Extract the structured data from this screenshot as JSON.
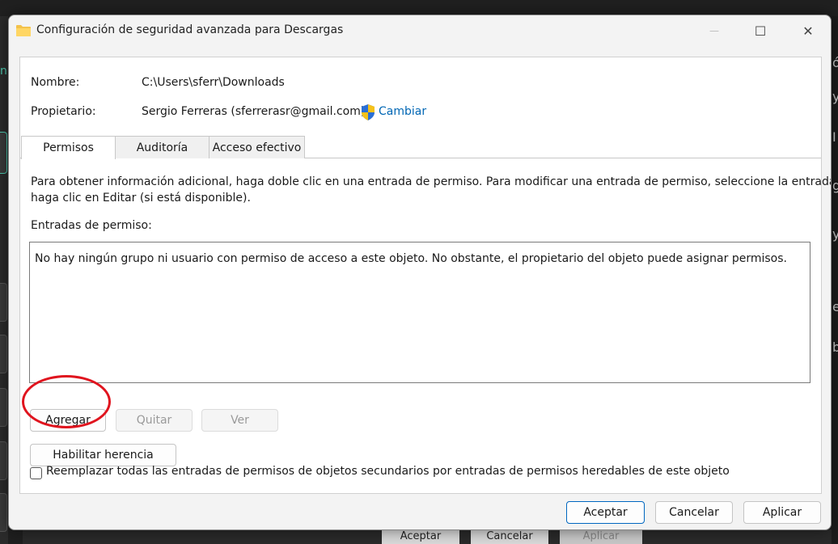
{
  "window": {
    "title": "Configuración de seguridad avanzada para Descargas",
    "minimize_glyph": "—",
    "maximize_glyph": "☐",
    "close_glyph": "✕"
  },
  "info": {
    "name_label": "Nombre:",
    "name_value": "C:\\Users\\sferr\\Downloads",
    "owner_label": "Propietario:",
    "owner_value": "Sergio Ferreras (sferrerasr@gmail.com)",
    "change_link": "Cambiar"
  },
  "tabs": [
    {
      "label": "Permisos",
      "active": true
    },
    {
      "label": "Auditoría",
      "active": false
    },
    {
      "label": "Acceso efectivo",
      "active": false
    }
  ],
  "permissions": {
    "help_line1": "Para obtener información adicional, haga doble clic en una entrada de permiso. Para modificar una entrada de permiso, seleccione la entrada y",
    "help_line2": "haga clic en Editar (si está disponible).",
    "entries_label": "Entradas de permiso:",
    "empty_message": "No hay ningún grupo ni usuario con permiso de acceso a este objeto. No obstante, el propietario del objeto puede asignar permisos.",
    "add_button": "Agregar",
    "remove_button": "Quitar",
    "view_button": "Ver",
    "inherit_button": "Habilitar herencia",
    "replace_checkbox_label": "Reemplazar todas las entradas de permisos de objetos secundarios por entradas de permisos heredables de este objeto",
    "replace_checked": false
  },
  "footer": {
    "ok": "Aceptar",
    "cancel": "Cancelar",
    "apply": "Aplicar"
  },
  "background_dialog": {
    "ok": "Aceptar",
    "cancel": "Cancelar",
    "apply": "Aplicar"
  },
  "colors": {
    "link": "#0066b4",
    "highlight_circle": "#e0141e",
    "primary_border": "#0067c0"
  }
}
